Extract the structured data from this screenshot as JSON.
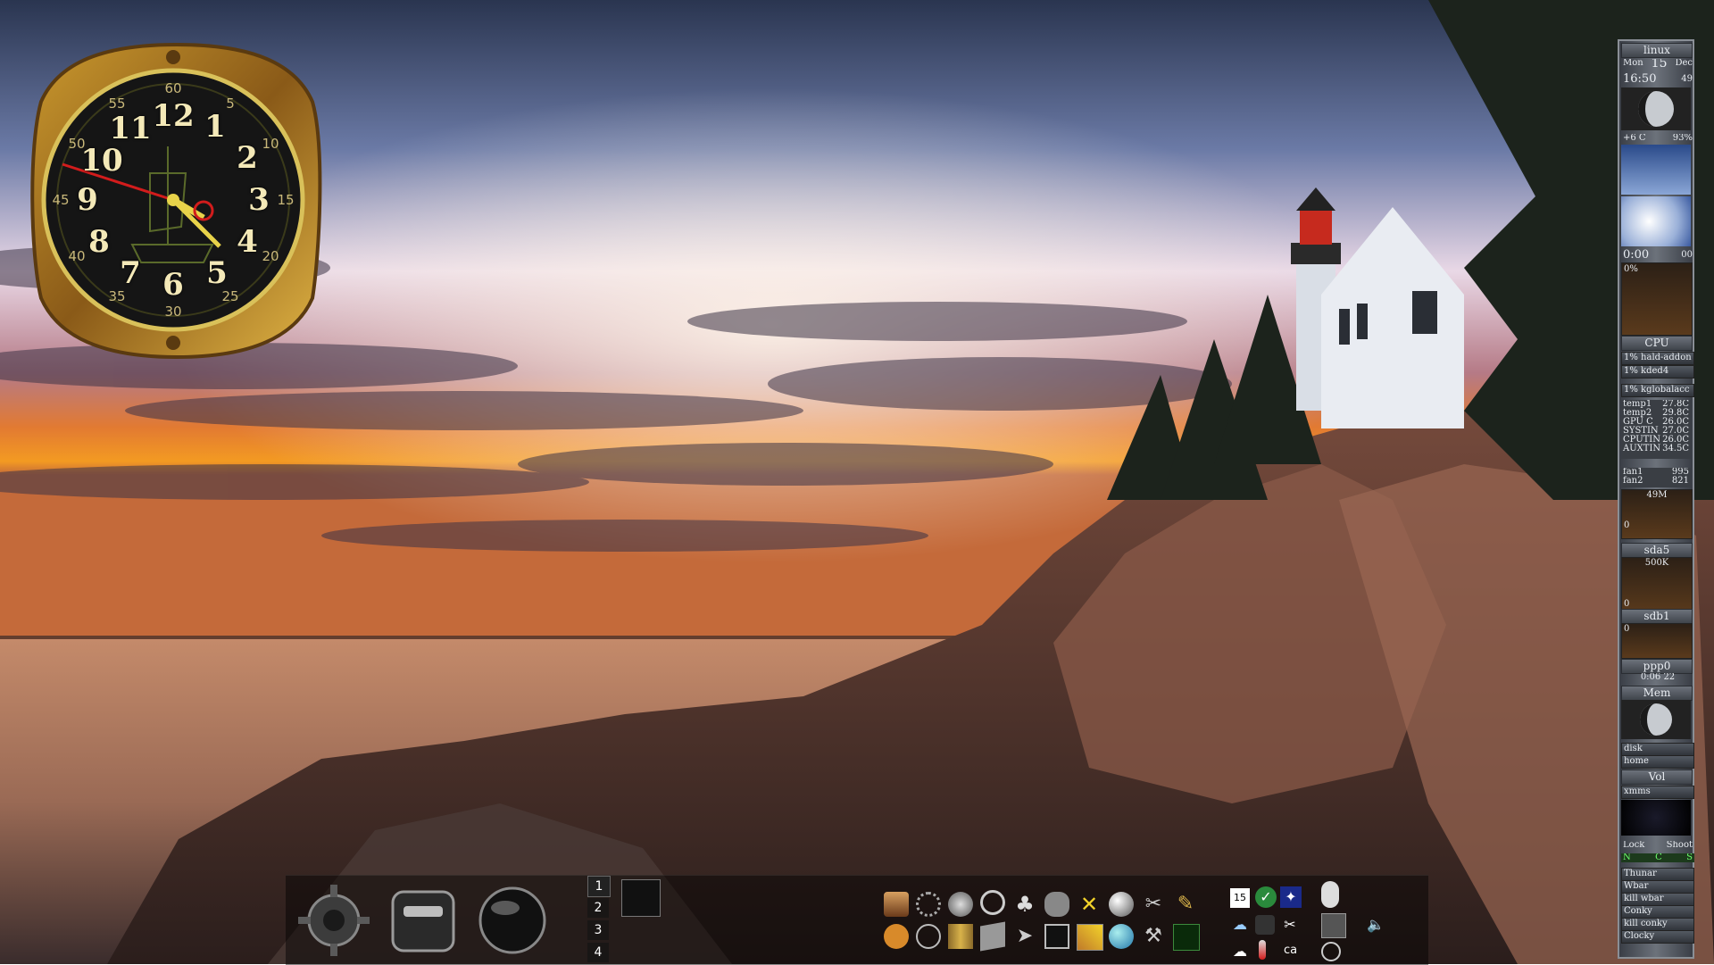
{
  "desktop": {
    "clock": {
      "numbers": [
        "12",
        "1",
        "2",
        "3",
        "4",
        "5",
        "6",
        "7",
        "8",
        "9",
        "10",
        "11"
      ],
      "minute_marks": [
        "60",
        "5",
        "10",
        "15",
        "20",
        "25",
        "30",
        "35",
        "40",
        "45",
        "50",
        "55"
      ]
    },
    "sysmon": {
      "hostname": "linux",
      "date": {
        "weekday": "Mon",
        "day": "15",
        "month": "Dec"
      },
      "time": "16:50",
      "seconds": "49",
      "temp_line": {
        "temp": "+6 C",
        "humidity": "93%"
      },
      "uptime": "0:00",
      "uptime_sec": "00",
      "cpu_percent_label": "0%",
      "cpu_label": "CPU",
      "processes": [
        "1% hald-addon",
        "1% kded4",
        "1% kglobalacc"
      ],
      "temps": [
        {
          "name": "temp1",
          "value": "27.8C"
        },
        {
          "name": "temp2",
          "value": "29.8C"
        },
        {
          "name": "GPU C",
          "value": "26.0C"
        },
        {
          "name": "SYSTIN",
          "value": "27.0C"
        },
        {
          "name": "CPUTIN",
          "value": "26.0C"
        },
        {
          "name": "AUXTIN",
          "value": "34.5C"
        }
      ],
      "fans": [
        {
          "name": "fan1",
          "value": "995"
        },
        {
          "name": "fan2",
          "value": "821"
        }
      ],
      "mem_chart_top": "49M",
      "mem_chart_bottom": "0",
      "disk1_label": "sda5",
      "disk1_top": "500K",
      "disk1_bottom": "0",
      "disk2_label": "sdb1",
      "disk2_top": "0",
      "net_label": "ppp0",
      "net_time": "0:06 22",
      "mem_label": "Mem",
      "disk_btn": "disk",
      "home_btn": "home",
      "vol_label": "Vol",
      "xmms_label": "xmms",
      "lock_label": "Lock",
      "shoot_label": "Shoot",
      "status_letters": [
        "N",
        "C",
        "S"
      ],
      "commands": [
        "Thunar",
        "Wbar",
        "kill wbar",
        "Conky",
        "kill conky",
        "Clocky"
      ]
    },
    "dock": {
      "desktops": [
        "1",
        "2",
        "3",
        "4"
      ],
      "active_desktop": "1",
      "tray_lang": "ca",
      "calendar_day": "15"
    },
    "colors": {
      "accent": "#ff8a1c",
      "panel": "#5a6068"
    }
  }
}
